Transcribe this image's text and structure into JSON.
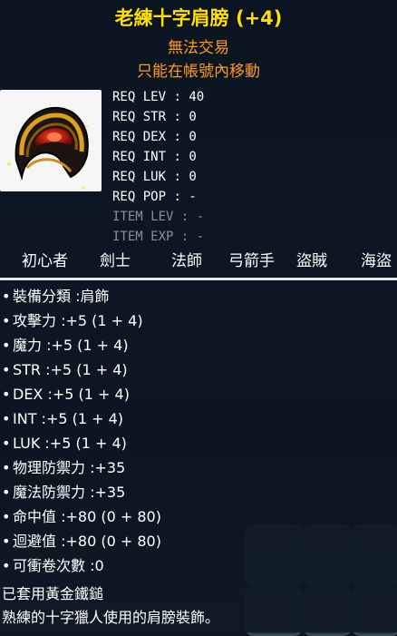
{
  "item": {
    "name": "老練十字肩膀 (+4)",
    "trade": "無法交易",
    "move": "只能在帳號內移動",
    "icon": "shoulder-pad-icon"
  },
  "requirements": [
    {
      "label": "REQ LEV",
      "value": "40",
      "dim": false
    },
    {
      "label": "REQ STR",
      "value": "0",
      "dim": false
    },
    {
      "label": "REQ DEX",
      "value": "0",
      "dim": false
    },
    {
      "label": "REQ INT",
      "value": "0",
      "dim": false
    },
    {
      "label": "REQ LUK",
      "value": "0",
      "dim": false
    },
    {
      "label": "REQ POP",
      "value": "-",
      "dim": false
    },
    {
      "label": "ITEM LEV",
      "value": "-",
      "dim": true
    },
    {
      "label": "ITEM EXP",
      "value": "-",
      "dim": true
    }
  ],
  "jobs": [
    "初心者",
    "劍士",
    "法師",
    "弓箭手",
    "盜賊",
    "海盜"
  ],
  "stats": [
    "裝備分類 :肩飾",
    "攻擊力 :+5 (1 + 4)",
    "魔力 :+5 (1 + 4)",
    "STR :+5 (1 + 4)",
    "DEX :+5 (1 + 4)",
    "INT :+5 (1 + 4)",
    "LUK :+5 (1 + 4)",
    "物理防禦力 :+35",
    "魔法防禦力 :+35",
    "命中值 :+80 (0 + 80)",
    "迴避值 :+80 (0 + 80)",
    "可衝卷次數 :0"
  ],
  "footer": {
    "enhance": "已套用黃金鐵鎚",
    "description": "熟練的十字獵人使用的肩膀裝飾。"
  },
  "colors": {
    "title": "#ffe100",
    "subtitle": "#ff9b1f",
    "text": "#ffffff",
    "dim": "#8a8f97"
  }
}
